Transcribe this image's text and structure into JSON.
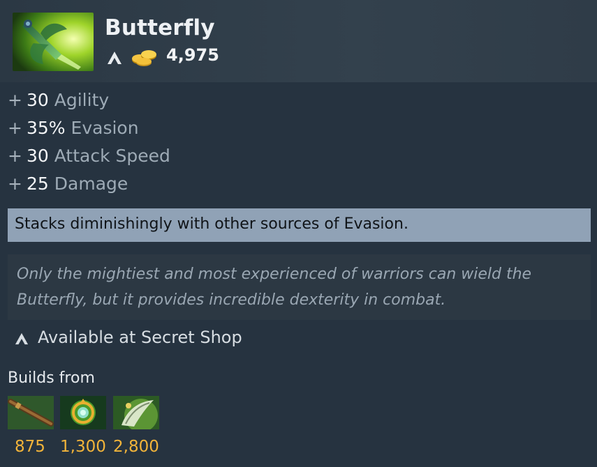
{
  "item": {
    "name": "Butterfly",
    "icon": "butterfly-item-icon",
    "cost": "4,975",
    "shop_icon": "secret-shop-icon",
    "gold_icon": "gold-coins-icon"
  },
  "stats": [
    {
      "plus": "+",
      "value": "30",
      "name": "Agility"
    },
    {
      "plus": "+",
      "value": "35%",
      "name": "Evasion"
    },
    {
      "plus": "+",
      "value": "30",
      "name": "Attack Speed"
    },
    {
      "plus": "+",
      "value": "25",
      "name": "Damage"
    }
  ],
  "note": "Stacks diminishingly with other sources of Evasion.",
  "lore": "Only the mightiest and most experienced of warriors can wield the Butterfly, but it provides incredible dexterity in combat.",
  "availability": "Available at Secret Shop",
  "builds_from": {
    "label": "Builds from",
    "components": [
      {
        "icon": "quarterstaff-icon",
        "price": "875"
      },
      {
        "icon": "talisman-of-evasion-icon",
        "price": "1,300"
      },
      {
        "icon": "eaglesong-icon",
        "price": "2,800"
      }
    ]
  },
  "colors": {
    "panel_bg": "#263340",
    "header_bg": "#33414d",
    "note_bg": "#90a2b6",
    "lore_bg": "#2c3843",
    "gold_text": "#f2b43a"
  }
}
